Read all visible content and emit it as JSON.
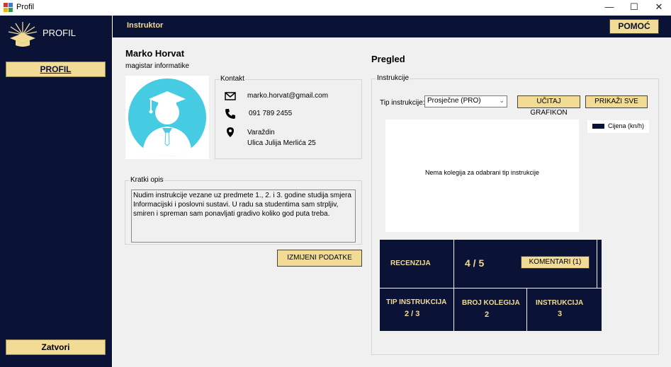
{
  "window": {
    "title": "Profil",
    "minimize": "—",
    "maximize": "☐",
    "close": "✕"
  },
  "sidebar": {
    "title": "PROFIL",
    "profil_button": "PROFIL",
    "close_button": "Zatvori"
  },
  "header": {
    "section": "Instruktor",
    "help_button": "POMOĆ"
  },
  "profile": {
    "name": "Marko Horvat",
    "degree": "magistar informatike",
    "contact_legend": "Kontakt",
    "email": "marko.horvat@gmail.com",
    "phone": "091 789 2455",
    "city": "Varaždin",
    "street": "Ulica Julija Merlića 25",
    "description_legend": "Kratki opis",
    "description": "Nudim instrukcije vezane uz predmete 1., 2. i 3. godine studija smjera Informacijski i poslovni sustavi. U radu sa studentima sam strpljiv, smiren i spreman sam ponavljati gradivo koliko god puta treba.",
    "edit_button": "IZMIJENI PODATKE"
  },
  "overview": {
    "title": "Pregled",
    "group_legend": "Instrukcije",
    "type_label": "Tip instrukcije:",
    "type_selected": "Prosječne (PRO)",
    "load_chart_button": "UČITAJ GRAFIKON",
    "show_all_button": "PRIKAŽI SVE",
    "chart_empty_message": "Nema kolegija za odabrani tip instrukcije",
    "chart_legend": "Cijena (kn/h)",
    "review_label": "RECENZIJA",
    "review_value": "4 / 5",
    "comments_button": "KOMENTARI (1)",
    "type_stat_label": "TIP INSTRUKCIJA",
    "type_stat_value": "2 / 3",
    "courses_label": "BROJ KOLEGIJA",
    "courses_value": "2",
    "instructions_label": "INSTRUKCIJA",
    "instructions_value": "3"
  },
  "colors": {
    "navy": "#0a1236",
    "gold": "#f2dc95",
    "avatar": "#45cbe2"
  }
}
